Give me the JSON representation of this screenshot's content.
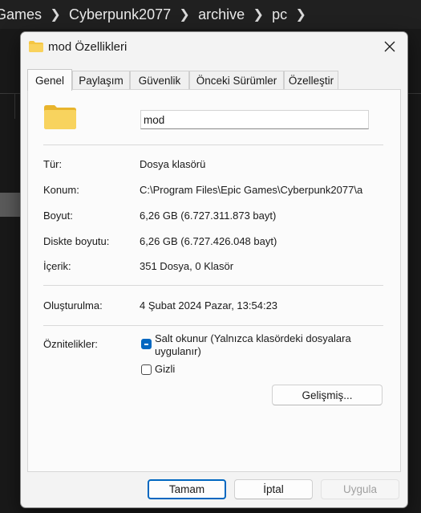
{
  "explorer": {
    "breadcrumb": [
      "Games",
      "Cyberpunk2077",
      "archive",
      "pc"
    ]
  },
  "dialog": {
    "title": "mod Özellikleri",
    "tabs": [
      {
        "label": "Genel",
        "active": true
      },
      {
        "label": "Paylaşım",
        "active": false
      },
      {
        "label": "Güvenlik",
        "active": false
      },
      {
        "label": "Önceki Sürümler",
        "active": false
      },
      {
        "label": "Özelleştir",
        "active": false
      }
    ],
    "name_value": "mod",
    "rows": {
      "type": {
        "label": "Tür:",
        "value": "Dosya klasörü"
      },
      "location": {
        "label": "Konum:",
        "value": "C:\\Program Files\\Epic Games\\Cyberpunk2077\\a"
      },
      "size": {
        "label": "Boyut:",
        "value": "6,26 GB (6.727.311.873 bayt)"
      },
      "disk_size": {
        "label": "Diskte boyutu:",
        "value": "6,26 GB (6.727.426.048 bayt)"
      },
      "contents": {
        "label": "İçerik:",
        "value": "351 Dosya, 0 Klasör"
      },
      "created": {
        "label": "Oluşturulma:",
        "value": "4 Şubat 2024 Pazar, 13:54:23"
      }
    },
    "attributes": {
      "label": "Öznitelikler:",
      "readonly_line1": "Salt okunur (Yalnızca klasördeki dosyalara",
      "readonly_line2": "uygulanır)",
      "readonly_state": "indeterminate",
      "hidden": "Gizli",
      "hidden_state": "unchecked",
      "advanced": "Gelişmiş..."
    },
    "buttons": {
      "ok": "Tamam",
      "cancel": "İptal",
      "apply": "Uygula"
    },
    "colors": {
      "accent": "#0067c0",
      "folder": "#f4c542"
    }
  }
}
